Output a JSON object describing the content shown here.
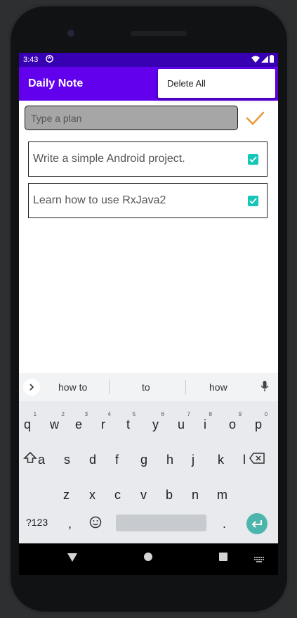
{
  "status": {
    "time": "3:43"
  },
  "appbar": {
    "title": "Daily Note",
    "menu_item": "Delete All"
  },
  "input": {
    "placeholder": "Type a plan",
    "value": ""
  },
  "items": [
    {
      "text": "Write a simple Android project.",
      "checked": true
    },
    {
      "text": "Learn how to use RxJava2",
      "checked": true
    }
  ],
  "keyboard": {
    "suggestions": [
      "how to",
      "to",
      "how"
    ],
    "row1": [
      {
        "key": "q",
        "hint": "1"
      },
      {
        "key": "w",
        "hint": "2"
      },
      {
        "key": "e",
        "hint": "3"
      },
      {
        "key": "r",
        "hint": "4"
      },
      {
        "key": "t",
        "hint": "5"
      },
      {
        "key": "y",
        "hint": "6"
      },
      {
        "key": "u",
        "hint": "7"
      },
      {
        "key": "i",
        "hint": "8"
      },
      {
        "key": "o",
        "hint": "9"
      },
      {
        "key": "p",
        "hint": "0"
      }
    ],
    "row2": [
      "a",
      "s",
      "d",
      "f",
      "g",
      "h",
      "j",
      "k",
      "l"
    ],
    "row3": [
      "z",
      "x",
      "c",
      "v",
      "b",
      "n",
      "m"
    ],
    "row4": {
      "symbols": "?123",
      "comma": ",",
      "period": "."
    }
  },
  "colors": {
    "statusbar": "#3700b3",
    "appbar": "#6200ee",
    "accent": "#14c7b9",
    "confirm": "#e89a3c"
  },
  "icons": [
    "sync-icon",
    "wifi-icon",
    "signal-icon",
    "battery-icon",
    "check-icon",
    "checkbox-icon",
    "chevron-right-icon",
    "mic-icon",
    "shift-icon",
    "backspace-icon",
    "emoji-icon",
    "enter-icon",
    "back-icon",
    "home-icon",
    "recents-icon",
    "keyboard-icon"
  ]
}
